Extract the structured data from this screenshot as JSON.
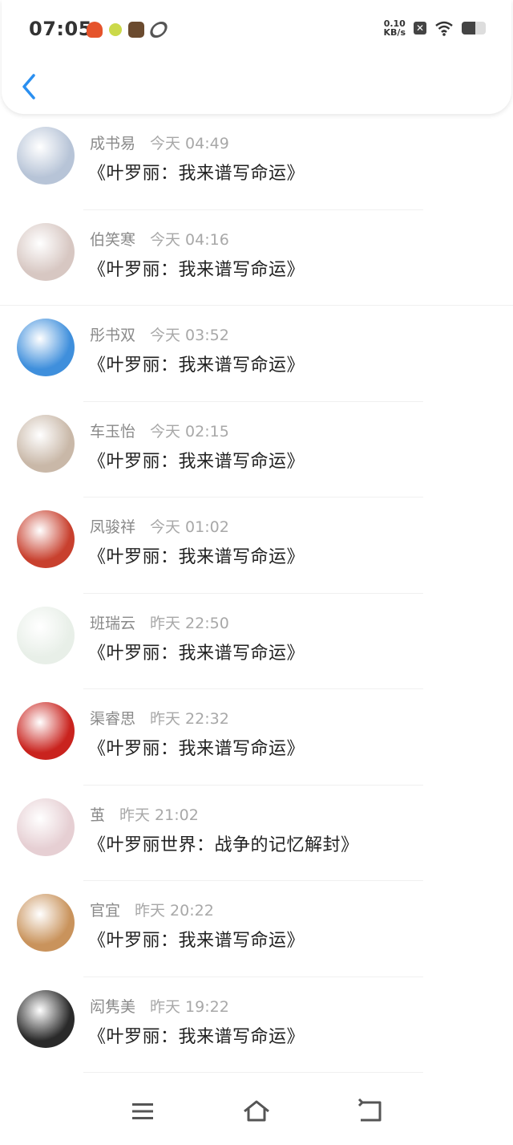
{
  "status_bar": {
    "time": "07:05",
    "net_speed_value": "0.10",
    "net_speed_unit": "KB/s",
    "battery_level": 0.55,
    "notification_icons": [
      "sale-icon",
      "bulb-icon",
      "game-icon",
      "ring-icon"
    ]
  },
  "nav": {
    "back_icon": "chevron-left-icon",
    "accent": "#2a8ff0"
  },
  "items": [
    {
      "name": "成书易",
      "time": "今天 04:49",
      "title": "《叶罗丽：我来谱写命运》",
      "avatar_color": "#b7c4d7"
    },
    {
      "name": "伯笑寒",
      "time": "今天 04:16",
      "title": "《叶罗丽：我来谱写命运》",
      "avatar_color": "#d7c7c2"
    },
    {
      "name": "彤书双",
      "time": "今天 03:52",
      "title": "《叶罗丽：我来谱写命运》",
      "avatar_color": "#3f8fdc"
    },
    {
      "name": "车玉怡",
      "time": "今天 02:15",
      "title": "《叶罗丽：我来谱写命运》",
      "avatar_color": "#c9b8a8"
    },
    {
      "name": "凤骏祥",
      "time": "今天 01:02",
      "title": "《叶罗丽：我来谱写命运》",
      "avatar_color": "#c8402e"
    },
    {
      "name": "班瑞云",
      "time": "昨天 22:50",
      "title": "《叶罗丽：我来谱写命运》",
      "avatar_color": "#e8efe8"
    },
    {
      "name": "渠睿思",
      "time": "昨天 22:32",
      "title": "《叶罗丽：我来谱写命运》",
      "avatar_color": "#c9231e"
    },
    {
      "name": "茧",
      "time": "昨天 21:02",
      "title": "《叶罗丽世界：战争的记忆解封》",
      "avatar_color": "#e6cfd3"
    },
    {
      "name": "官宜",
      "time": "昨天 20:22",
      "title": "《叶罗丽：我来谱写命运》",
      "avatar_color": "#c9935c"
    },
    {
      "name": "闳隽美",
      "time": "昨天 19:22",
      "title": "《叶罗丽：我来谱写命运》",
      "avatar_color": "#2a2a2a"
    }
  ],
  "bottom_nav": {
    "menu_icon": "menu-icon",
    "home_icon": "home-icon",
    "back_icon": "back-icon"
  }
}
